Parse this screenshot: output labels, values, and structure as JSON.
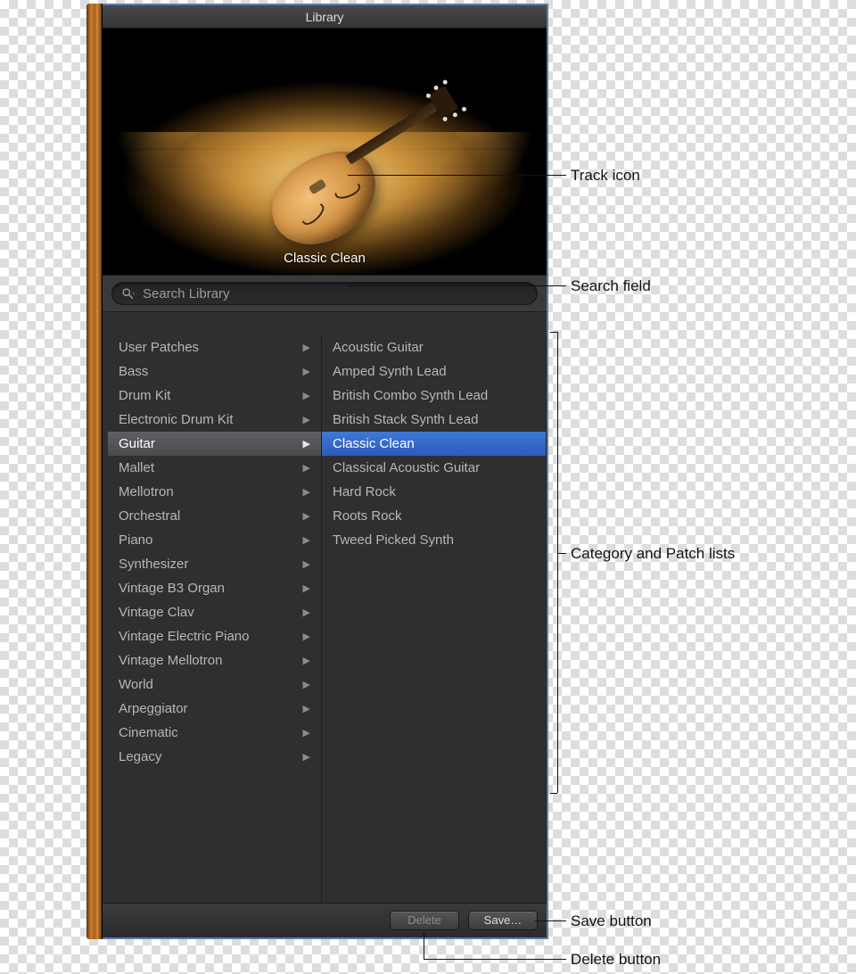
{
  "header": {
    "title": "Library"
  },
  "stage": {
    "patch_name": "Classic Clean"
  },
  "search": {
    "placeholder": "Search Library"
  },
  "categories": [
    {
      "label": "User Patches",
      "has_children": true,
      "selected": false
    },
    {
      "label": "Bass",
      "has_children": true,
      "selected": false
    },
    {
      "label": "Drum Kit",
      "has_children": true,
      "selected": false
    },
    {
      "label": "Electronic Drum Kit",
      "has_children": true,
      "selected": false
    },
    {
      "label": "Guitar",
      "has_children": true,
      "selected": true
    },
    {
      "label": "Mallet",
      "has_children": true,
      "selected": false
    },
    {
      "label": "Mellotron",
      "has_children": true,
      "selected": false
    },
    {
      "label": "Orchestral",
      "has_children": true,
      "selected": false
    },
    {
      "label": "Piano",
      "has_children": true,
      "selected": false
    },
    {
      "label": "Synthesizer",
      "has_children": true,
      "selected": false
    },
    {
      "label": "Vintage B3 Organ",
      "has_children": true,
      "selected": false
    },
    {
      "label": "Vintage Clav",
      "has_children": true,
      "selected": false
    },
    {
      "label": "Vintage Electric Piano",
      "has_children": true,
      "selected": false
    },
    {
      "label": "Vintage Mellotron",
      "has_children": true,
      "selected": false
    },
    {
      "label": "World",
      "has_children": true,
      "selected": false
    },
    {
      "label": "Arpeggiator",
      "has_children": true,
      "selected": false
    },
    {
      "label": "Cinematic",
      "has_children": true,
      "selected": false
    },
    {
      "label": "Legacy",
      "has_children": true,
      "selected": false
    }
  ],
  "patches": [
    {
      "label": "Acoustic Guitar",
      "selected": false
    },
    {
      "label": "Amped Synth Lead",
      "selected": false
    },
    {
      "label": "British Combo Synth Lead",
      "selected": false
    },
    {
      "label": "British Stack Synth Lead",
      "selected": false
    },
    {
      "label": "Classic Clean",
      "selected": true
    },
    {
      "label": "Classical Acoustic Guitar",
      "selected": false
    },
    {
      "label": "Hard Rock",
      "selected": false
    },
    {
      "label": "Roots Rock",
      "selected": false
    },
    {
      "label": "Tweed Picked Synth",
      "selected": false
    }
  ],
  "footer": {
    "delete_label": "Delete",
    "save_label": "Save…"
  },
  "annotations": {
    "track_icon": "Track icon",
    "search_field": "Search field",
    "lists": "Category and Patch lists",
    "save_button": "Save button",
    "delete_button": "Delete button"
  }
}
